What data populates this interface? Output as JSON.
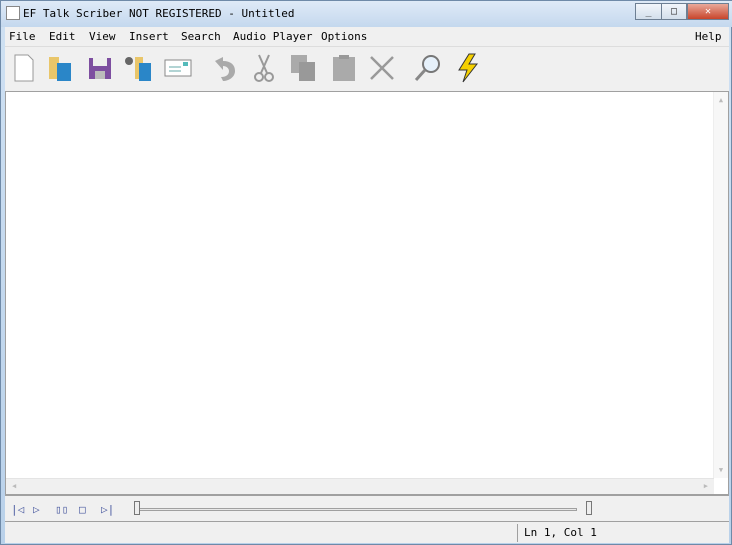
{
  "window": {
    "title": "EF Talk Scriber NOT REGISTERED - Untitled"
  },
  "menu": {
    "items": [
      "File",
      "Edit",
      "View",
      "Insert",
      "Search",
      "Audio Player",
      "Options"
    ],
    "help": "Help"
  },
  "toolbar": {
    "buttons": [
      "new-document",
      "open-folder",
      "save",
      "open-audio",
      "email",
      "undo",
      "cut",
      "copy",
      "paste",
      "delete",
      "find",
      "quick-action"
    ]
  },
  "player": {
    "buttons": [
      "skip-back",
      "play",
      "pause",
      "stop",
      "skip-forward"
    ],
    "position": 0,
    "volume": 1
  },
  "status": {
    "position": "Ln 1, Col 1"
  }
}
